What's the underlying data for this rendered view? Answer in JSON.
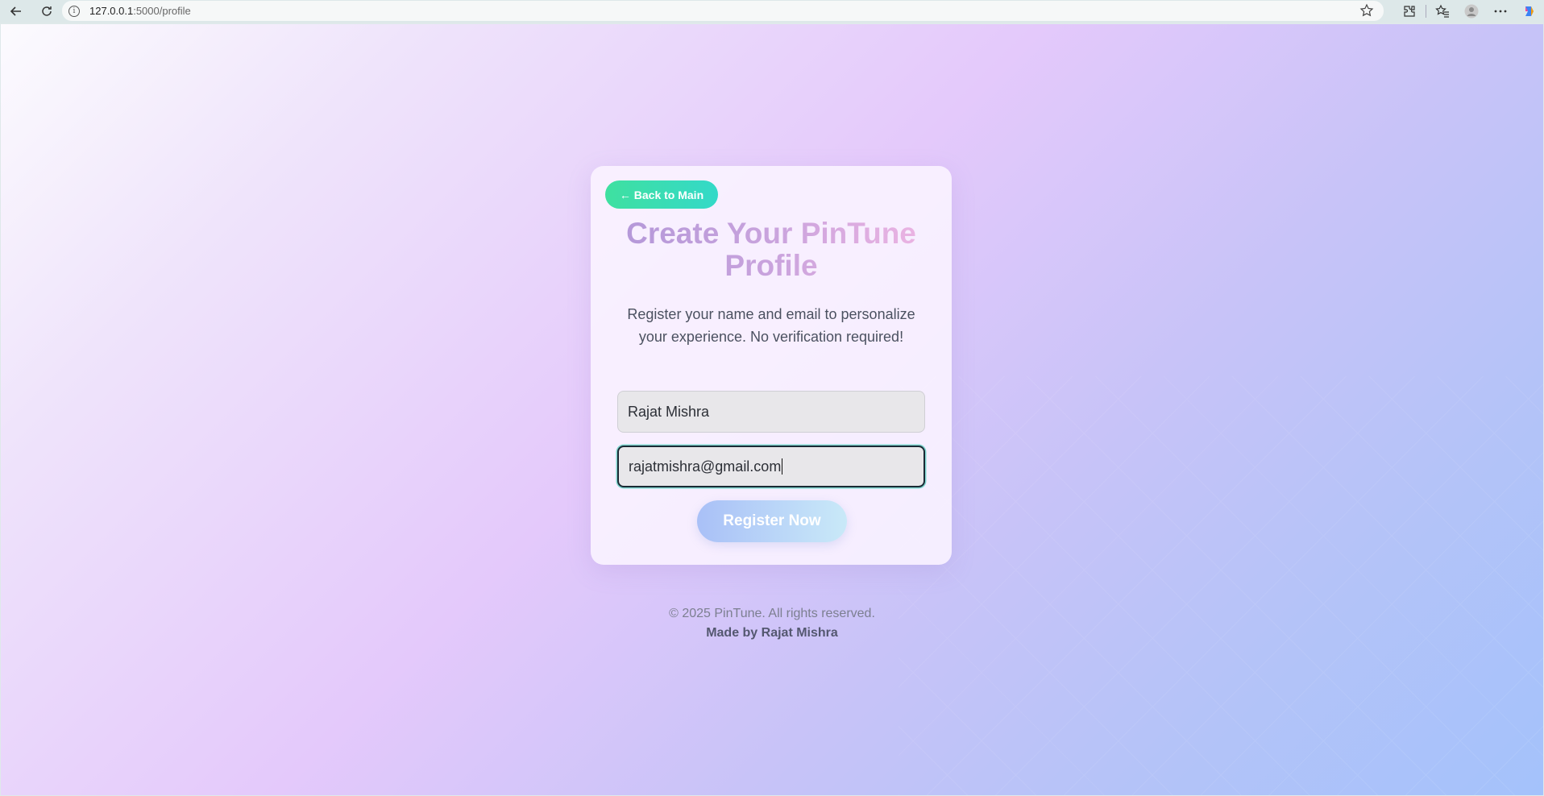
{
  "browser": {
    "url_host": "127.0.0.1",
    "url_rest": ":5000/profile",
    "icons": [
      "back-icon",
      "reload-icon",
      "info-icon",
      "star-icon",
      "extensions-icon",
      "favorites-icon",
      "profile-icon",
      "more-icon",
      "copilot-icon"
    ]
  },
  "card": {
    "back_label": "← Back to Main",
    "title_line1": "Create Your PinTune",
    "title_line2": "Profile",
    "subtitle": "Register your name and email to personalize your experience. No verification required!",
    "name_value": "Rajat Mishra",
    "email_value": "rajatmishra@gmail.com",
    "register_label": "Register Now"
  },
  "footer": {
    "copyright": "© 2025 PinTune. All rights reserved.",
    "made_by": "Made by Rajat Mishra"
  },
  "colors": {
    "back_button": "#3fe0a0",
    "register_button": "#a9c0f7",
    "title_gradient_start": "#b096d8",
    "title_gradient_end": "#f2b7e4"
  }
}
